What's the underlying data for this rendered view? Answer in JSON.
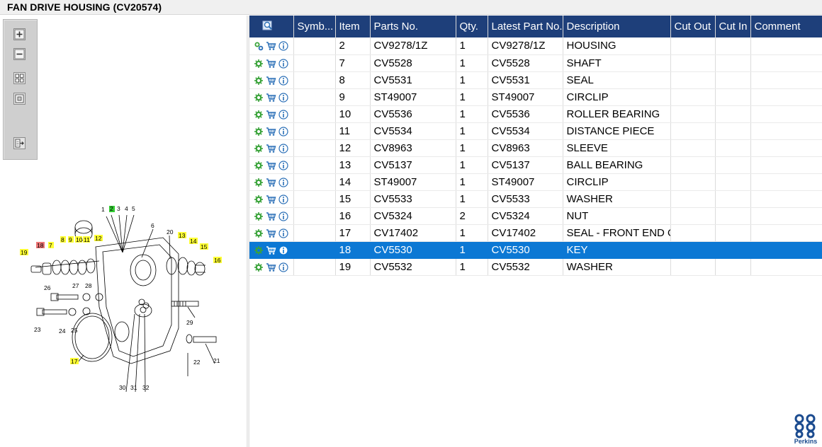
{
  "window": {
    "title": "FAN DRIVE HOUSING (CV20574)"
  },
  "toolbar": {
    "buttons": [
      {
        "name": "zoom-in",
        "icon": "zoom-in-icon"
      },
      {
        "name": "zoom-out",
        "icon": "zoom-out-icon"
      },
      {
        "name": "fit-to-window",
        "icon": "fit-window-icon"
      },
      {
        "name": "actual-size",
        "icon": "actual-size-icon"
      },
      {
        "name": "export",
        "icon": "export-icon"
      }
    ]
  },
  "diagram": {
    "labels": [
      "1",
      "2",
      "3",
      "4",
      "5",
      "6",
      "7",
      "8",
      "9",
      "10",
      "11",
      "12",
      "13",
      "14",
      "15",
      "16",
      "17",
      "18",
      "19",
      "20",
      "21",
      "22",
      "23",
      "24",
      "25",
      "26",
      "27",
      "28",
      "29",
      "30",
      "31",
      "32"
    ],
    "highlight_colors": {
      "yellow": "#ffff33",
      "green": "#33cc33",
      "red": "#ee7777"
    }
  },
  "table": {
    "columns": [
      "",
      "Symb...",
      "Item",
      "Parts No.",
      "Qty.",
      "Latest Part No.",
      "Description",
      "Cut Out",
      "Cut In",
      "Comment"
    ],
    "header_icon": "search-parts-icon",
    "rows": [
      {
        "item": "2",
        "part": "CV9278/1Z",
        "qty": "1",
        "latest": "CV9278/1Z",
        "desc": "HOUSING",
        "cut_out": "",
        "cut_in": "",
        "comment": "",
        "symbol": "",
        "gear": "gears"
      },
      {
        "item": "7",
        "part": "CV5528",
        "qty": "1",
        "latest": "CV5528",
        "desc": "SHAFT",
        "cut_out": "",
        "cut_in": "",
        "comment": "",
        "symbol": "",
        "gear": "gear"
      },
      {
        "item": "8",
        "part": "CV5531",
        "qty": "1",
        "latest": "CV5531",
        "desc": "SEAL",
        "cut_out": "",
        "cut_in": "",
        "comment": "",
        "symbol": "",
        "gear": "gear"
      },
      {
        "item": "9",
        "part": "ST49007",
        "qty": "1",
        "latest": "ST49007",
        "desc": "CIRCLIP",
        "cut_out": "",
        "cut_in": "",
        "comment": "",
        "symbol": "",
        "gear": "gear"
      },
      {
        "item": "10",
        "part": "CV5536",
        "qty": "1",
        "latest": "CV5536",
        "desc": "ROLLER BEARING",
        "cut_out": "",
        "cut_in": "",
        "comment": "",
        "symbol": "",
        "gear": "gear"
      },
      {
        "item": "11",
        "part": "CV5534",
        "qty": "1",
        "latest": "CV5534",
        "desc": "DISTANCE PIECE",
        "cut_out": "",
        "cut_in": "",
        "comment": "",
        "symbol": "",
        "gear": "gear"
      },
      {
        "item": "12",
        "part": "CV8963",
        "qty": "1",
        "latest": "CV8963",
        "desc": "SLEEVE",
        "cut_out": "",
        "cut_in": "",
        "comment": "",
        "symbol": "",
        "gear": "gear"
      },
      {
        "item": "13",
        "part": "CV5137",
        "qty": "1",
        "latest": "CV5137",
        "desc": "BALL BEARING",
        "cut_out": "",
        "cut_in": "",
        "comment": "",
        "symbol": "",
        "gear": "gear"
      },
      {
        "item": "14",
        "part": "ST49007",
        "qty": "1",
        "latest": "ST49007",
        "desc": "CIRCLIP",
        "cut_out": "",
        "cut_in": "",
        "comment": "",
        "symbol": "",
        "gear": "gear"
      },
      {
        "item": "15",
        "part": "CV5533",
        "qty": "1",
        "latest": "CV5533",
        "desc": "WASHER",
        "cut_out": "",
        "cut_in": "",
        "comment": "",
        "symbol": "",
        "gear": "gear"
      },
      {
        "item": "16",
        "part": "CV5324",
        "qty": "2",
        "latest": "CV5324",
        "desc": "NUT",
        "cut_out": "",
        "cut_in": "",
        "comment": "",
        "symbol": "",
        "gear": "gear"
      },
      {
        "item": "17",
        "part": "CV17402",
        "qty": "1",
        "latest": "CV17402",
        "desc": "SEAL - FRONT END OI",
        "cut_out": "",
        "cut_in": "",
        "comment": "",
        "symbol": "",
        "gear": "gear"
      },
      {
        "item": "18",
        "part": "CV5530",
        "qty": "1",
        "latest": "CV5530",
        "desc": "KEY",
        "cut_out": "",
        "cut_in": "",
        "comment": "",
        "symbol": "",
        "gear": "gear",
        "selected": true
      },
      {
        "item": "19",
        "part": "CV5532",
        "qty": "1",
        "latest": "CV5532",
        "desc": "WASHER",
        "cut_out": "",
        "cut_in": "",
        "comment": "",
        "symbol": "",
        "gear": "gear"
      }
    ]
  },
  "brand": {
    "name": "Perkins",
    "color": "#1b4b8f"
  },
  "colors": {
    "header_bg": "#1e3f7a",
    "selected_row": "#0c78d4",
    "gear": "#3aa33a",
    "cart": "#2a6fb7",
    "info": "#2a6fb7"
  }
}
